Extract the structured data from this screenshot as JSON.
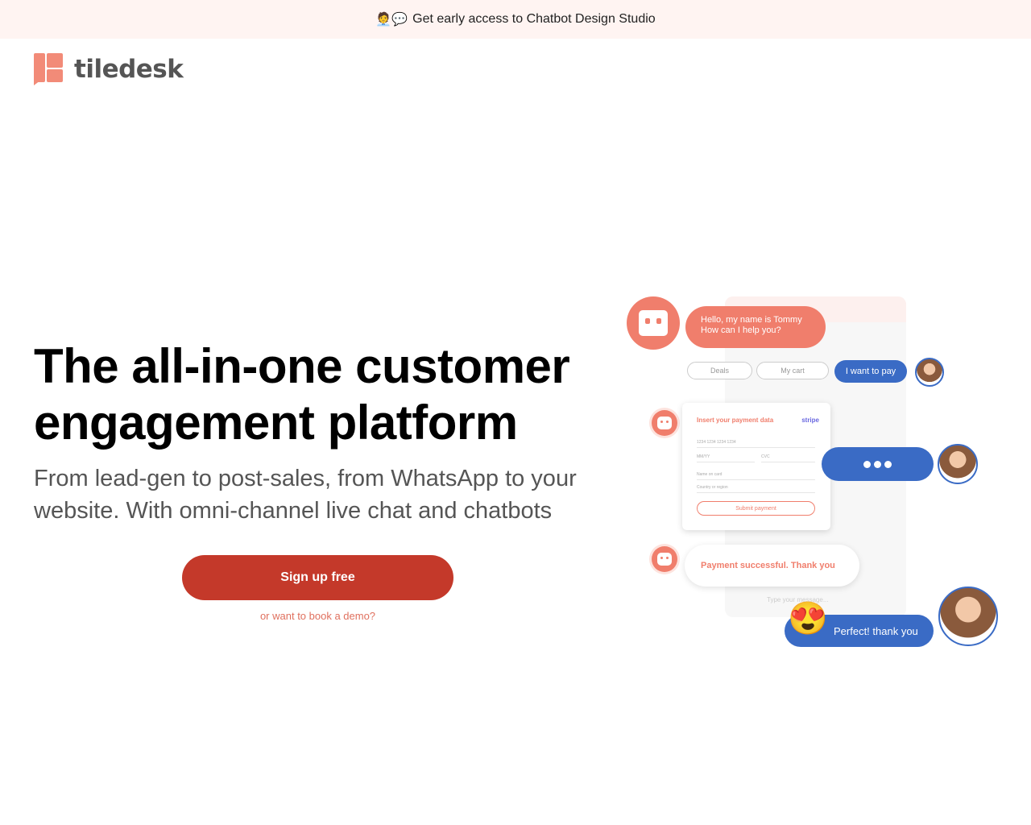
{
  "banner": {
    "emoji": "🧑‍💼💬",
    "text": "Get early access to Chatbot Design Studio"
  },
  "logo": {
    "text": "tiledesk"
  },
  "hero": {
    "title": "The all-in-one customer engagement platform",
    "subtitle": "From lead-gen to post-sales, from WhatsApp to your website. With omni-channel live chat and chatbots",
    "signup_label": "Sign up free",
    "demo_label": "or want to book a demo?"
  },
  "illustration": {
    "bot_greeting_line1": "Hello, my name is Tommy",
    "bot_greeting_line2": "How can I help you?",
    "chips": [
      "Deals",
      "My cart"
    ],
    "user_choice": "I want to pay",
    "payment_card": {
      "title": "Insert your payment data",
      "brand": "stripe",
      "card_number_placeholder": "1234 1234 1234 1234",
      "expiry_placeholder": "MM/YY",
      "cvc_placeholder": "CVC",
      "name_placeholder": "Name on card",
      "country_placeholder": "Country or region",
      "submit_label": "Submit payment"
    },
    "success_message": "Payment successful. Thank you",
    "input_placeholder": "Type your message...",
    "user_reply": "Perfect! thank you",
    "reply_emoji": "😍"
  },
  "colors": {
    "brand": "#f07e6c",
    "cta": "#c4392a",
    "user_bubble": "#3a6bc5",
    "banner_bg": "#fff4f2"
  }
}
